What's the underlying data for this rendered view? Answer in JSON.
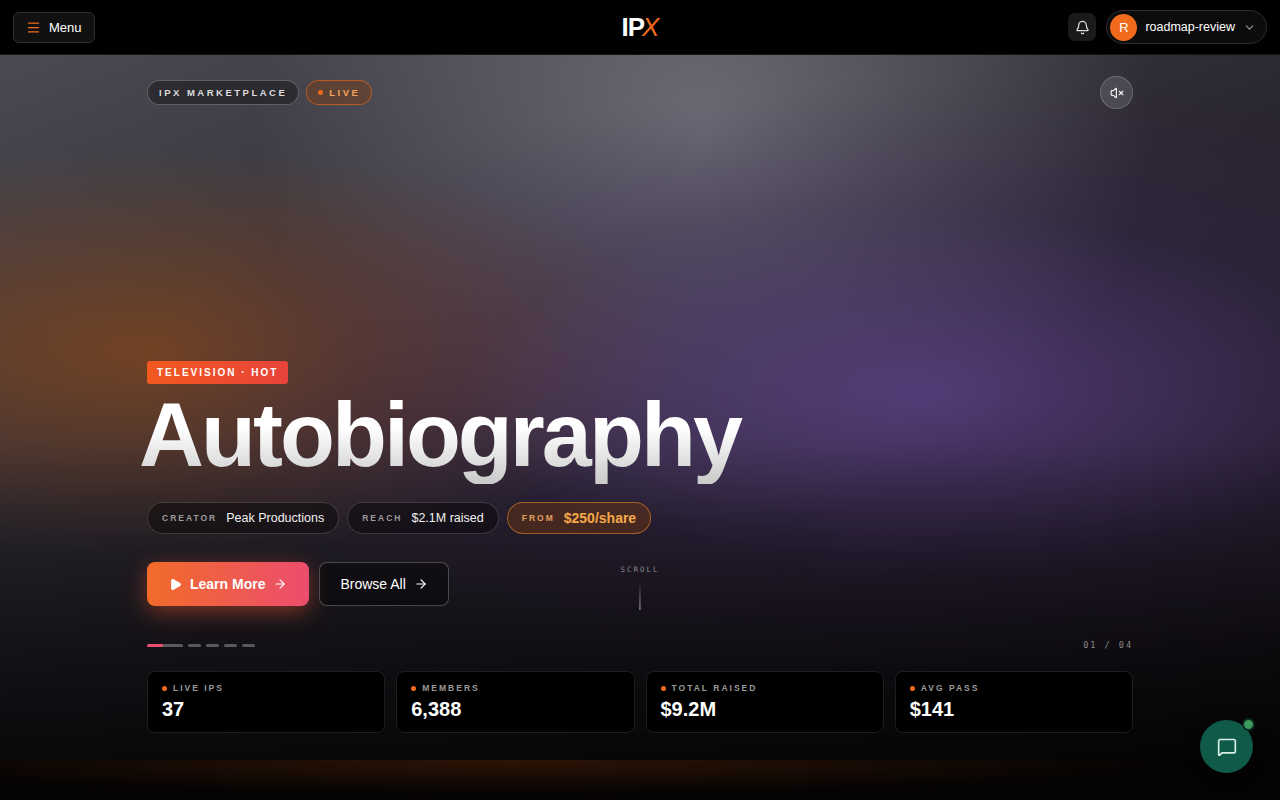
{
  "nav": {
    "menu_label": "Menu",
    "logo": {
      "text": "IP",
      "accent": "X"
    },
    "user": {
      "initial": "R",
      "name": "roadmap-review"
    }
  },
  "hero": {
    "badges": [
      {
        "label": "IPX MARKETPLACE",
        "live": false
      },
      {
        "label": "LIVE",
        "live": true
      }
    ],
    "muted": true,
    "tag": "TELEVISION · HOT",
    "title": "Autobiography",
    "chips": [
      {
        "label": "CREATOR",
        "value": "Peak Productions",
        "highlight": false
      },
      {
        "label": "REACH",
        "value": "$2.1M raised",
        "highlight": false
      },
      {
        "label": "FROM",
        "value": "$250/share",
        "highlight": true
      }
    ],
    "buttons": [
      {
        "label": "Learn More",
        "primary": true
      },
      {
        "label": "Browse All",
        "primary": false
      }
    ],
    "scroll_label": "SCROLL",
    "slides": [
      {
        "selected": true
      },
      {
        "selected": false
      },
      {
        "selected": false
      },
      {
        "selected": false
      },
      {
        "selected": false
      }
    ],
    "counter": "01 / 04"
  },
  "stats": [
    {
      "label": "LIVE IPS",
      "value": "37"
    },
    {
      "label": "MEMBERS",
      "value": "6,388"
    },
    {
      "label": "TOTAL RAISED",
      "value": "$9.2M"
    },
    {
      "label": "AVG PASS",
      "value": "$141"
    }
  ],
  "chat": {
    "online": true
  }
}
